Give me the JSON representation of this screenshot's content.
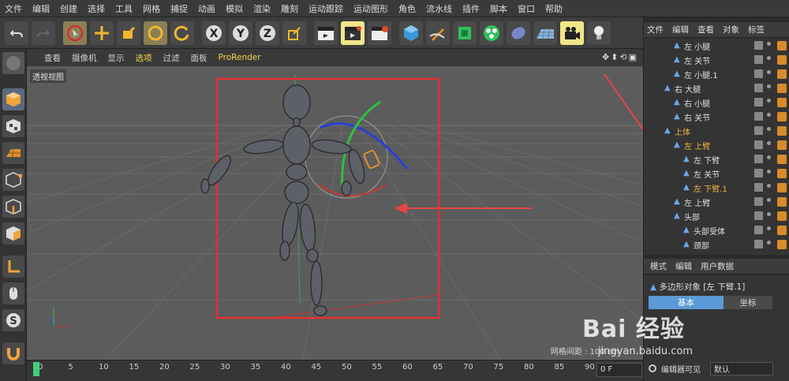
{
  "menu": [
    "文件",
    "编辑",
    "创建",
    "选择",
    "工具",
    "网格",
    "捕捉",
    "动画",
    "模拟",
    "渲染",
    "雕刻",
    "运动跟踪",
    "运动图形",
    "角色",
    "流水线",
    "插件",
    "脚本",
    "窗口",
    "帮助"
  ],
  "viewport": {
    "menu": [
      "查看",
      "摄像机",
      "显示",
      "选项",
      "过滤",
      "面板",
      "ProRender"
    ],
    "label": "透视视图",
    "grid_info": "网格间距 : 100 cm"
  },
  "object_manager": {
    "menu": [
      "文件",
      "编辑",
      "查看",
      "对象",
      "标签"
    ],
    "tree": [
      {
        "name": "左 小腿",
        "selected": false
      },
      {
        "name": "左 关节",
        "selected": false
      },
      {
        "name": "左 小腿.1",
        "selected": false
      },
      {
        "name": "右 大腿",
        "selected": false
      },
      {
        "name": "右 小腿",
        "selected": false
      },
      {
        "name": "右 关节",
        "selected": false
      },
      {
        "name": "上体",
        "selected": true
      },
      {
        "name": "左 上臂",
        "selected": true
      },
      {
        "name": "左 下臂",
        "selected": false
      },
      {
        "name": "左 关节",
        "selected": false
      },
      {
        "name": "左 下臂.1",
        "selected": true
      },
      {
        "name": "左 上臂",
        "selected": false
      },
      {
        "name": "头部",
        "selected": false
      },
      {
        "name": "头部受体",
        "selected": false
      },
      {
        "name": "颈部",
        "selected": false
      }
    ]
  },
  "attribute_manager": {
    "menu": [
      "模式",
      "编辑",
      "用户数据"
    ],
    "title": "多边形对象 [左 下臂.1]",
    "tabs": [
      "基本",
      "坐标"
    ],
    "row_label": "编辑器可见",
    "row_value": "默认"
  },
  "timeline": {
    "ticks": [
      "0",
      "5",
      "10",
      "15",
      "20",
      "25",
      "30",
      "35",
      "40",
      "45",
      "50",
      "55",
      "60",
      "65",
      "70",
      "75",
      "80",
      "85",
      "90"
    ],
    "frame": "0 F"
  },
  "watermark": {
    "main": "Bai 经验",
    "sub": "jingyan.baidu.com"
  },
  "colors": {
    "accent": "#f3d64b",
    "selection_box": "#e23030",
    "arrow": "#e84545",
    "timeline_head": "#3fd07a"
  }
}
